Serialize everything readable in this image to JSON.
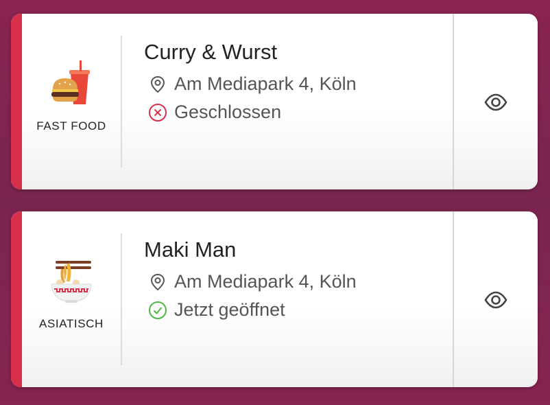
{
  "colors": {
    "accent": "#d8304a",
    "closed": "#d8304a",
    "open": "#4cb944"
  },
  "cards": [
    {
      "category_label": "FAST FOOD",
      "category_icon": "burger-and-drink-icon",
      "name": "Curry & Wurst",
      "address": "Am Mediapark 4, Köln",
      "status": "Geschlossen",
      "status_icon": "closed-x-icon"
    },
    {
      "category_label": "ASIATISCH",
      "category_icon": "noodle-bowl-chopsticks-icon",
      "name": "Maki Man",
      "address": "Am Mediapark 4, Köln",
      "status": "Jetzt geöffnet",
      "status_icon": "open-check-icon"
    }
  ]
}
